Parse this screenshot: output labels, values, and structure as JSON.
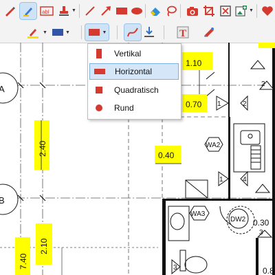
{
  "toolbar_row1": {
    "tools": [
      {
        "name": "pen-icon",
        "color": "#d43a2f"
      },
      {
        "name": "highlighter-icon",
        "color": "#3b7ad8"
      },
      {
        "name": "text-box-icon",
        "text": "abl",
        "color": "#d43a2f"
      },
      {
        "name": "stamp-icon",
        "color": "#d43a2f"
      },
      {
        "name": "line-icon",
        "color": "#d43a2f"
      },
      {
        "name": "arrow-icon",
        "color": "#d43a2f"
      },
      {
        "name": "rectangle-icon",
        "color": "#d43a2f"
      },
      {
        "name": "ellipse-icon",
        "color": "#d43a2f"
      },
      {
        "name": "eraser-icon",
        "color": "#2f8fd8"
      },
      {
        "name": "lasso-icon",
        "color": "#d43a2f"
      },
      {
        "name": "camera-icon",
        "color": "#d43a2f"
      },
      {
        "name": "crop-icon",
        "color": "#d43a2f"
      },
      {
        "name": "fit-page-icon",
        "color": "#d43a2f"
      },
      {
        "name": "add-image-icon",
        "color": "#2e8b57"
      },
      {
        "name": "favorite-icon",
        "color": "#d43a2f"
      }
    ]
  },
  "toolbar_row2": {
    "pen_color": "#f5e400",
    "fill_color": "#3355a6",
    "shape_color": "#d43a2f",
    "text_tool_label": "T"
  },
  "shape_menu": {
    "items": [
      {
        "label": "Vertikal",
        "selected": false,
        "shape": "vertical"
      },
      {
        "label": "Horizontal",
        "selected": true,
        "shape": "horizontal"
      },
      {
        "label": "Quadratisch",
        "selected": false,
        "shape": "square"
      },
      {
        "label": "Rund",
        "selected": false,
        "shape": "round"
      }
    ]
  },
  "drawing": {
    "dimensions": [
      "1.10",
      "0.70",
      "2.40",
      "0.40",
      "2.10",
      "7.40",
      "0.30",
      "0.8"
    ],
    "grid_labels": [
      "A",
      "B"
    ],
    "room_tags": [
      "WA2",
      "WA3",
      "DW2"
    ],
    "door_numbers": [
      "1",
      "2",
      "3",
      "4"
    ],
    "highlight_color": "#ffff00"
  }
}
